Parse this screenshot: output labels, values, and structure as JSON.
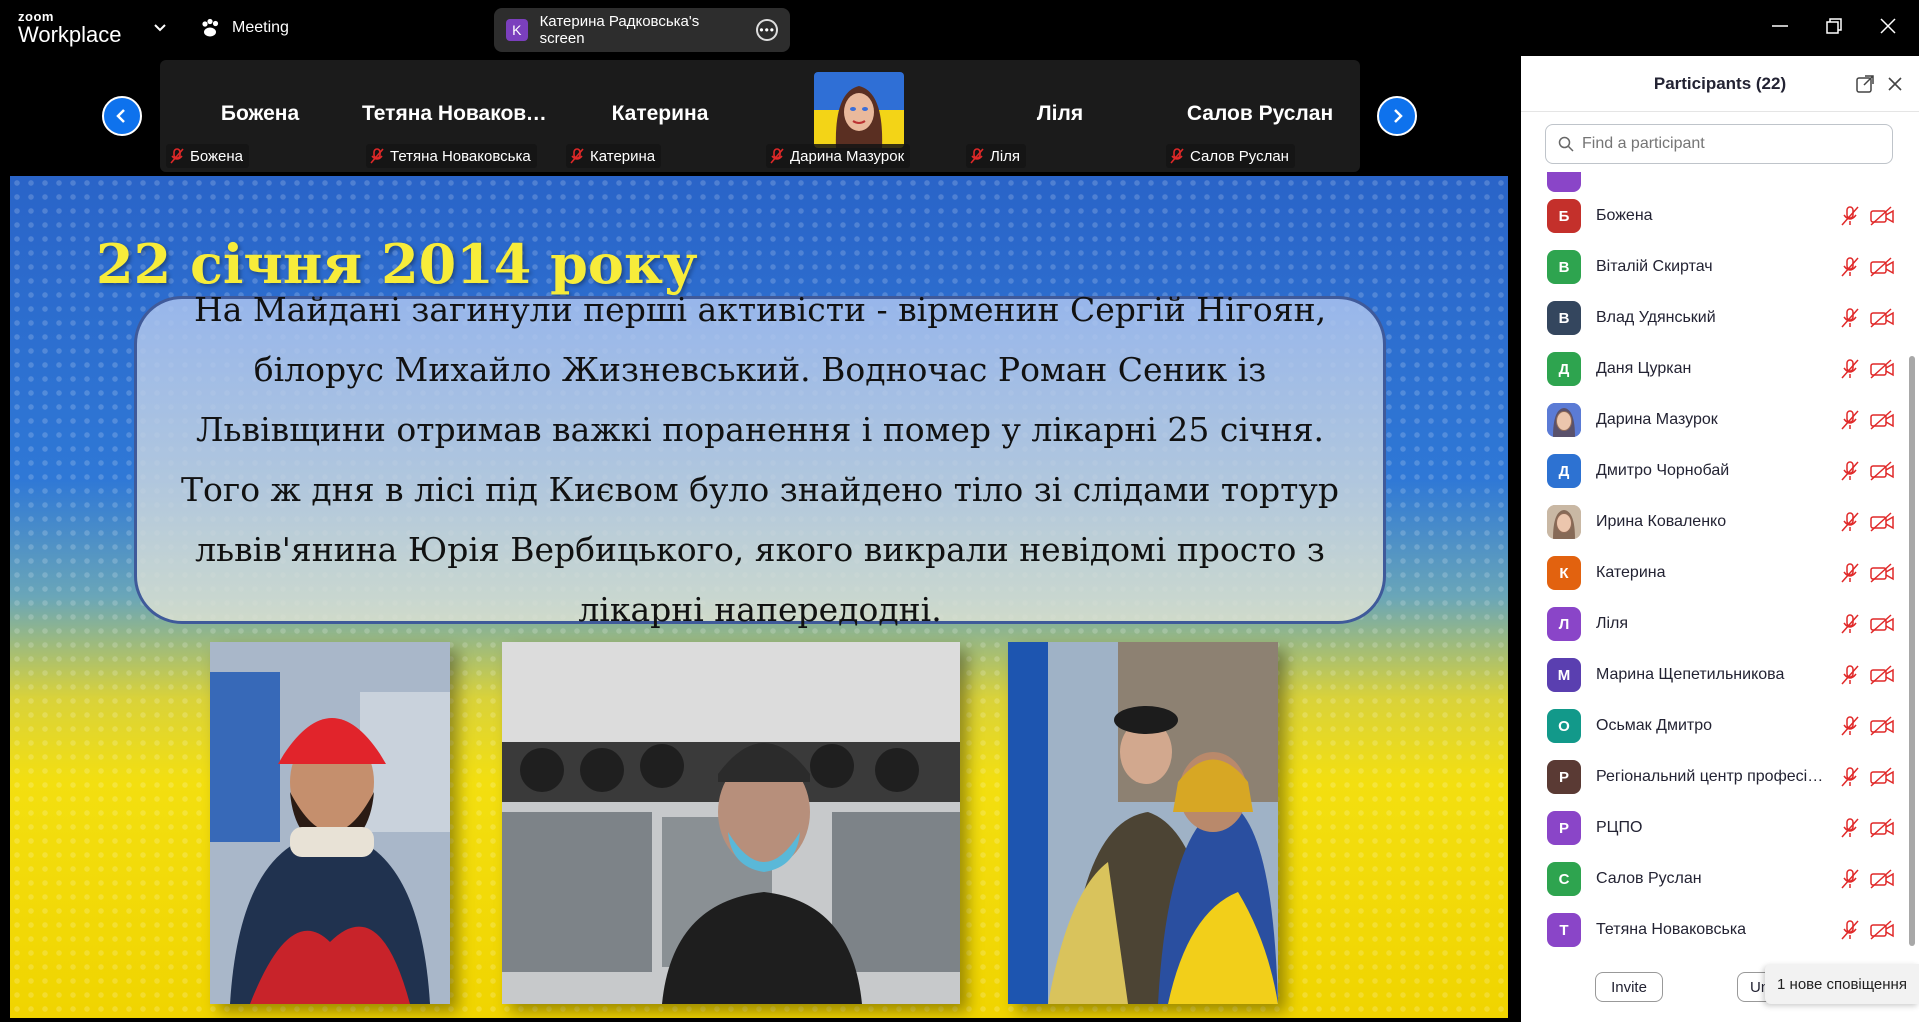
{
  "app": {
    "logo_top": "zoom",
    "logo_bottom": "Workplace",
    "meeting_label": "Meeting"
  },
  "share_pill": {
    "avatar_letter": "K",
    "label": "Катерина Радковська's screen",
    "avatar_color": "#7b3fbd"
  },
  "gallery": [
    {
      "name": "Божена",
      "label": "Божена",
      "video": false
    },
    {
      "name": "Тетяна Новаковська",
      "label": "Тетяна Новаковська",
      "video": false
    },
    {
      "name": "Катерина",
      "label": "Катерина",
      "video": false
    },
    {
      "name": "",
      "label": "Дарина Мазурок",
      "video": true
    },
    {
      "name": "Ліля",
      "label": "Ліля",
      "video": false
    },
    {
      "name": "Салов Руслан",
      "label": "Салов Руслан",
      "video": false
    }
  ],
  "slide": {
    "title": "22 січня 2014 року",
    "text": "На Майдані загинули перші активісти - вірменин Сергій Нігоян, білорус Михайло Жизневський. Водночас Роман Сеник із Львівщини отримав важкі поранення і помер у лікарні 25 січня. Того ж дня в лісі під Києвом було знайдено тіло зі слідами тортур львів'янина Юрія Вербицького, якого викрали невідомі просто з лікарні напередодні."
  },
  "participants_panel": {
    "title": "Participants (22)",
    "search_placeholder": "Find a participant",
    "invite_label": "Invite",
    "unmute_label": "Un",
    "items": [
      {
        "initial": "Б",
        "name": "Божена",
        "color": "#c4302b",
        "photo": false
      },
      {
        "initial": "В",
        "name": "Віталій Скиртач",
        "color": "#2ea44f",
        "photo": false
      },
      {
        "initial": "В",
        "name": "Влад Удянський",
        "color": "#34465e",
        "photo": false
      },
      {
        "initial": "Д",
        "name": "Даня Цуркан",
        "color": "#2ea44f",
        "photo": false
      },
      {
        "initial": "",
        "name": "Дарина Мазурок",
        "color": "#5b7bd5",
        "photo": true
      },
      {
        "initial": "Д",
        "name": "Дмитро Чорнобай",
        "color": "#2d72d2",
        "photo": false
      },
      {
        "initial": "",
        "name": "Ирина Коваленко",
        "color": "#c9b8a4",
        "photo": true
      },
      {
        "initial": "К",
        "name": "Катерина",
        "color": "#e2620f",
        "photo": false
      },
      {
        "initial": "Л",
        "name": "Ліля",
        "color": "#8a45c8",
        "photo": false
      },
      {
        "initial": "М",
        "name": "Марина Щепетильникова",
        "color": "#5a3fb0",
        "photo": false
      },
      {
        "initial": "О",
        "name": "Осьмак Дмитро",
        "color": "#12998a",
        "photo": false
      },
      {
        "initial": "Р",
        "name": "Регіональний центр професійн...",
        "color": "#5a3a34",
        "photo": false
      },
      {
        "initial": "Р",
        "name": "РЦПО",
        "color": "#8a45c8",
        "photo": false
      },
      {
        "initial": "С",
        "name": "Салов Руслан",
        "color": "#2ea44f",
        "photo": false
      },
      {
        "initial": "Т",
        "name": "Тетяна Новаковська",
        "color": "#8a45c8",
        "photo": false
      }
    ]
  },
  "notification": {
    "text": "1 нове сповіщення"
  },
  "colors": {
    "accent": "#0e72ed",
    "muted_red": "#e02828"
  }
}
